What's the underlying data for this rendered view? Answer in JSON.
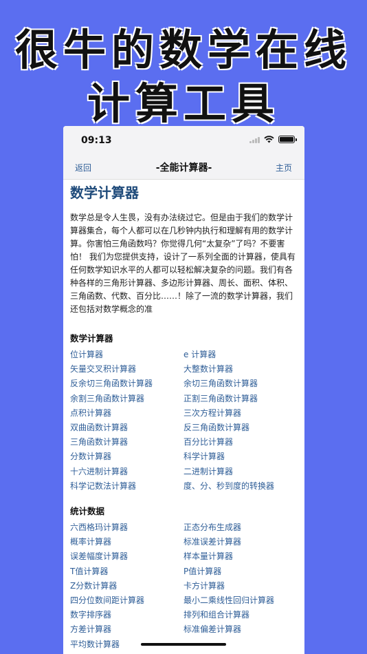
{
  "promo": {
    "line1": "很牛的数学在线",
    "line2": "计算工具"
  },
  "status_bar": {
    "time": "09:13"
  },
  "nav": {
    "back": "返回",
    "title": "-全能计算器-",
    "home": "主页"
  },
  "page": {
    "title": "数学计算器",
    "intro": "数学总是令人生畏，没有办法绕过它。但是由于我们的数学计算器集合，每个人都可以在几秒钟内执行和理解有用的数学计算。你害怕三角函数吗？你觉得几何“太复杂”了吗？不要害怕！ 我们为您提供支持，设计了一系列全面的计算器，使具有任何数学知识水平的人都可以轻松解决复杂的问题。我们有各种各样的三角形计算器、多边形计算器、周长、面积、体积、三角函数、代数、百分比……！除了一流的数学计算器，我们还包括对数学概念的准"
  },
  "sections": [
    {
      "title": "数学计算器",
      "links": [
        "位计算器",
        "e 计算器",
        "矢量交叉积计算器",
        "大整数计算器",
        "反余切三角函数计算器",
        "余切三角函数计算器",
        "余割三角函数计算器",
        "正割三角函数计算器",
        "点积计算器",
        "三次方程计算器",
        "双曲函数计算器",
        "反三角函数计算器",
        "三角函数计算器",
        "百分比计算器",
        "分数计算器",
        "科学计算器",
        "十六进制计算器",
        "二进制计算器",
        "科学记数法计算器",
        "度、分、秒到度的转换器"
      ]
    },
    {
      "title": "统计数据",
      "links": [
        "六西格玛计算器",
        "正态分布生成器",
        "概率计算器",
        "标准误差计算器",
        "误差幅度计算器",
        "样本量计算器",
        "T值计算器",
        "P值计算器",
        "Z分数计算器",
        "卡方计算器",
        "四分位数间距计算器",
        "最小二乘线性回归计算器",
        "数字排序器",
        "排列和组合计算器",
        "方差计算器",
        "标准偏差计算器",
        "平均数计算器"
      ]
    }
  ]
}
